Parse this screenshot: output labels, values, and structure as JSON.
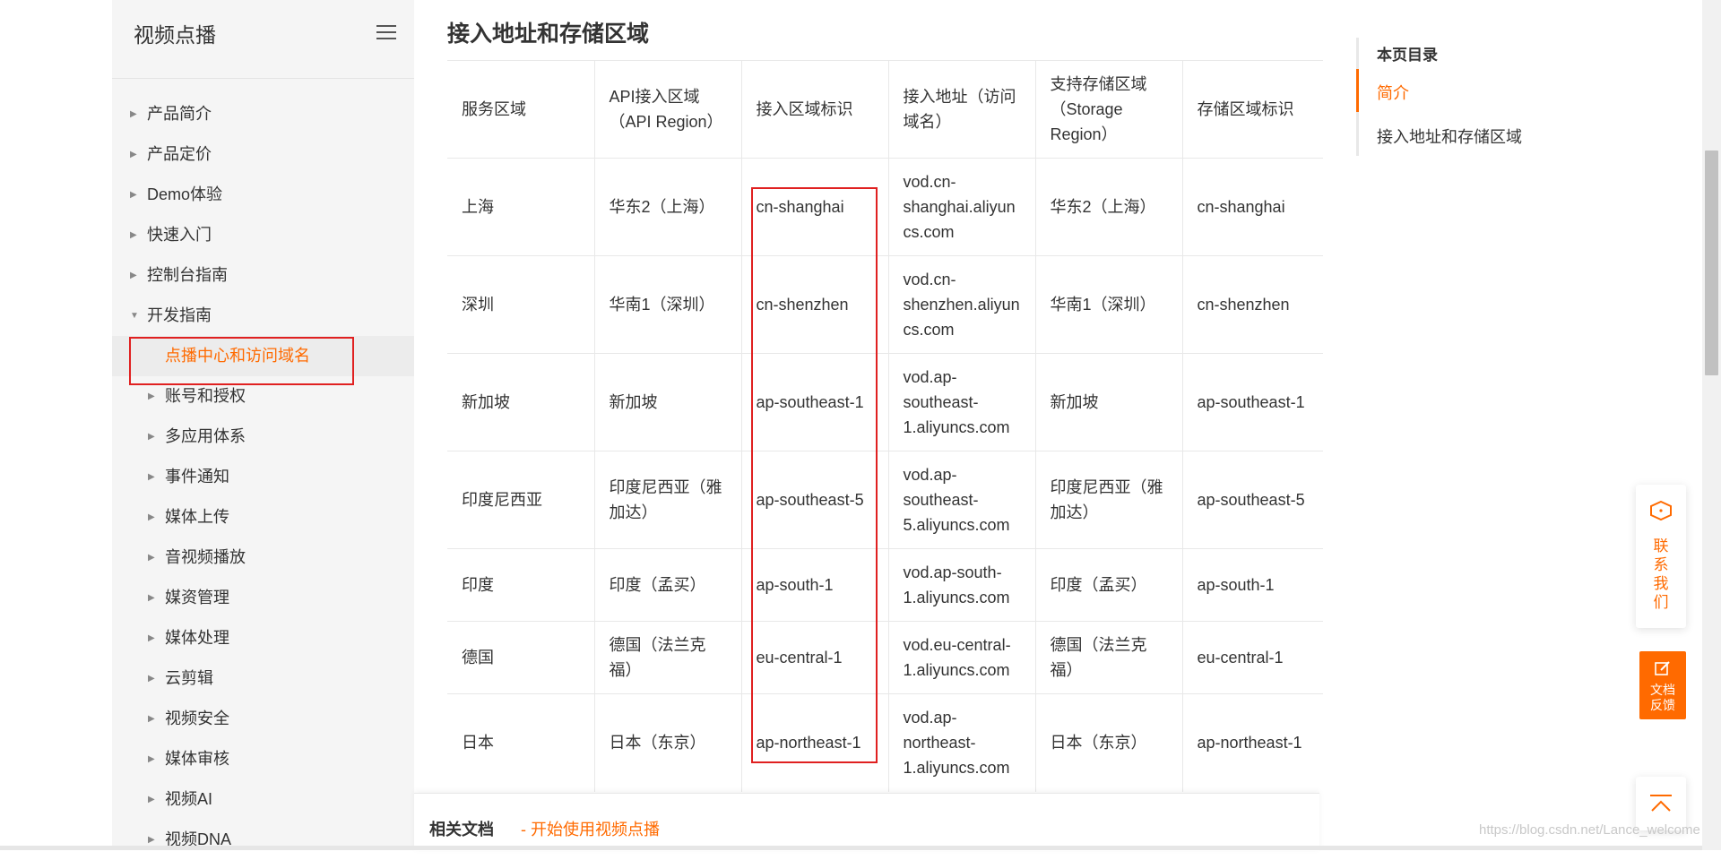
{
  "sidebar": {
    "title": "视频点播",
    "items": [
      {
        "label": "产品简介",
        "level": 1,
        "expanded": false
      },
      {
        "label": "产品定价",
        "level": 1,
        "expanded": false
      },
      {
        "label": "Demo体验",
        "level": 1,
        "expanded": false
      },
      {
        "label": "快速入门",
        "level": 1,
        "expanded": false
      },
      {
        "label": "控制台指南",
        "level": 1,
        "expanded": false
      },
      {
        "label": "开发指南",
        "level": 1,
        "expanded": true
      },
      {
        "label": "点播中心和访问域名",
        "level": 2,
        "active": true
      },
      {
        "label": "账号和授权",
        "level": 2,
        "expanded": false
      },
      {
        "label": "多应用体系",
        "level": 2,
        "expanded": false
      },
      {
        "label": "事件通知",
        "level": 2,
        "expanded": false
      },
      {
        "label": "媒体上传",
        "level": 2,
        "expanded": false
      },
      {
        "label": "音视频播放",
        "level": 2,
        "expanded": false
      },
      {
        "label": "媒资管理",
        "level": 2,
        "expanded": false
      },
      {
        "label": "媒体处理",
        "level": 2,
        "expanded": false
      },
      {
        "label": "云剪辑",
        "level": 2,
        "expanded": false
      },
      {
        "label": "视频安全",
        "level": 2,
        "expanded": false
      },
      {
        "label": "媒体审核",
        "level": 2,
        "expanded": false
      },
      {
        "label": "视频AI",
        "level": 2,
        "expanded": false
      },
      {
        "label": "视频DNA",
        "level": 2,
        "expanded": false
      }
    ]
  },
  "main": {
    "section_title": "接入地址和存储区域",
    "table": {
      "headers": [
        [
          "服务区域"
        ],
        [
          "API接入区域",
          "（API Region）"
        ],
        [
          "接入区域标识"
        ],
        [
          "接入地址（访问",
          "域名）"
        ],
        [
          "支持存储区域",
          "（Storage",
          "Region）"
        ],
        [
          "存储区域标识"
        ]
      ],
      "rows": [
        [
          [
            "上海"
          ],
          [
            "华东2（上海）"
          ],
          [
            "cn-shanghai"
          ],
          [
            "vod.cn-",
            "shanghai.aliyun",
            "cs.com"
          ],
          [
            "华东2（上海）"
          ],
          [
            "cn-shanghai"
          ]
        ],
        [
          [
            "深圳"
          ],
          [
            "华南1（深圳）"
          ],
          [
            "cn-shenzhen"
          ],
          [
            "vod.cn-",
            "shenzhen.aliyun",
            "cs.com"
          ],
          [
            "华南1（深圳）"
          ],
          [
            "cn-shenzhen"
          ]
        ],
        [
          [
            "新加坡"
          ],
          [
            "新加坡"
          ],
          [
            "ap-southeast-1"
          ],
          [
            "vod.ap-",
            "southeast-",
            "1.aliyuncs.com"
          ],
          [
            "新加坡"
          ],
          [
            "ap-southeast-1"
          ]
        ],
        [
          [
            "印度尼西亚"
          ],
          [
            "印度尼西亚（雅",
            "加达）"
          ],
          [
            "ap-southeast-5"
          ],
          [
            "vod.ap-",
            "southeast-",
            "5.aliyuncs.com"
          ],
          [
            "印度尼西亚（雅",
            "加达）"
          ],
          [
            "ap-southeast-5"
          ]
        ],
        [
          [
            "印度"
          ],
          [
            "印度（孟买）"
          ],
          [
            "ap-south-1"
          ],
          [
            "vod.ap-south-",
            "1.aliyuncs.com"
          ],
          [
            "印度（孟买）"
          ],
          [
            "ap-south-1"
          ]
        ],
        [
          [
            "德国"
          ],
          [
            "德国（法兰克",
            "福）"
          ],
          [
            "eu-central-1"
          ],
          [
            "vod.eu-central-",
            "1.aliyuncs.com"
          ],
          [
            "德国（法兰克",
            "福）"
          ],
          [
            "eu-central-1"
          ]
        ],
        [
          [
            "日本"
          ],
          [
            "日本（东京）"
          ],
          [
            "ap-northeast-1"
          ],
          [
            "vod.ap-",
            "northeast-",
            "1.aliyuncs.com"
          ],
          [
            "日本（东京）"
          ],
          [
            "ap-northeast-1"
          ]
        ]
      ]
    },
    "related": {
      "label": "相关文档",
      "link": "- 开始使用视频点播"
    }
  },
  "toc": {
    "title": "本页目录",
    "items": [
      {
        "label": "简介",
        "active": true
      },
      {
        "label": "接入地址和存储区域",
        "active": false
      }
    ]
  },
  "floating": {
    "contact_label": "联\n系\n我\n们",
    "feedback_label": "文档\n反馈"
  },
  "watermark": "https://blog.csdn.net/Lance_welcome",
  "colors": {
    "accent": "#ff6a00",
    "highlight_border": "#e02020",
    "sidebar_bg": "#f5f5f5"
  },
  "icons": {
    "menu": "hamburger-icon",
    "collapsed": "caret-right-icon",
    "expanded": "caret-down-icon",
    "contact": "chat-bubble-icon",
    "feedback": "edit-icon",
    "back_to_top": "arrow-up-icon"
  }
}
